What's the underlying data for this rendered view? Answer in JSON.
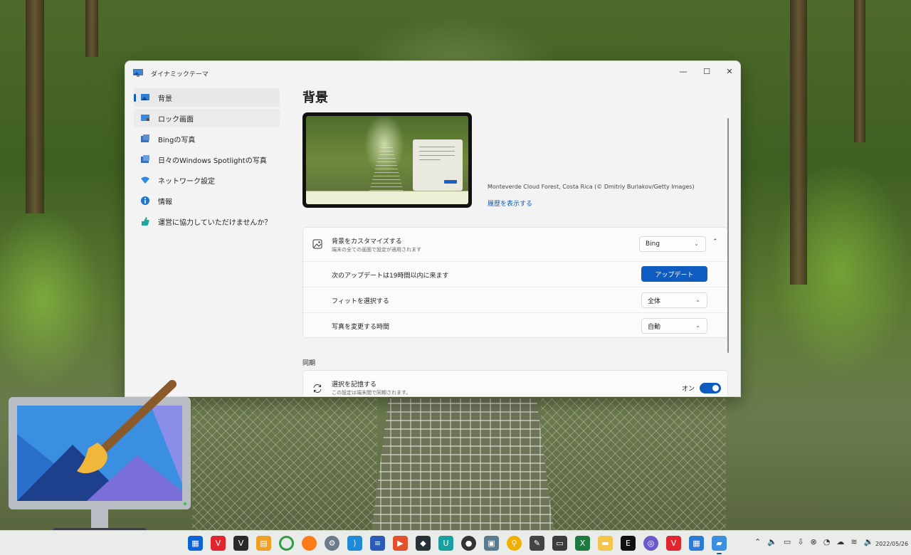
{
  "window": {
    "title": "ダイナミックテーマ",
    "minimize": "—",
    "maximize": "☐",
    "close": "✕"
  },
  "sidebar": {
    "items": [
      {
        "label": "背景",
        "icon": "wallpaper-icon"
      },
      {
        "label": "ロック画面",
        "icon": "lock-screen-icon"
      },
      {
        "label": "Bingの写真",
        "icon": "bing-photos-icon"
      },
      {
        "label": "日々のWindows Spotlightの写真",
        "icon": "spotlight-icon"
      },
      {
        "label": "ネットワーク設定",
        "icon": "wifi-icon"
      },
      {
        "label": "情報",
        "icon": "info-icon"
      },
      {
        "label": "運営に協力していただけませんか？",
        "icon": "thumbs-up-icon"
      }
    ]
  },
  "main": {
    "title": "背景",
    "photo_caption": "Monteverde Cloud Forest, Costa Rica (© Dmitriy Burlakov/Getty Images)",
    "history_link": "履歴を表示する",
    "customize": {
      "label": "背景をカスタマイズする",
      "sub": "端末の全ての画面で設定が適用されます",
      "value": "Bing"
    },
    "update": {
      "label": "次のアップデートは19時間以内に来ます",
      "button": "アップデート"
    },
    "fit": {
      "label": "フィットを選択する",
      "value": "全体"
    },
    "change_time": {
      "label": "写真を変更する時間",
      "value": "自動"
    },
    "sync_section": "同期",
    "sync": {
      "label": "選択を記憶する",
      "sub": "この設定は端末間で同期されます。",
      "state": "オン"
    }
  },
  "taskbar": {
    "date": "2022/05/26"
  },
  "colors": {
    "accent": "#0e5cc0",
    "window_bg": "#f3f3f3",
    "card_bg": "#fbfbfb"
  }
}
